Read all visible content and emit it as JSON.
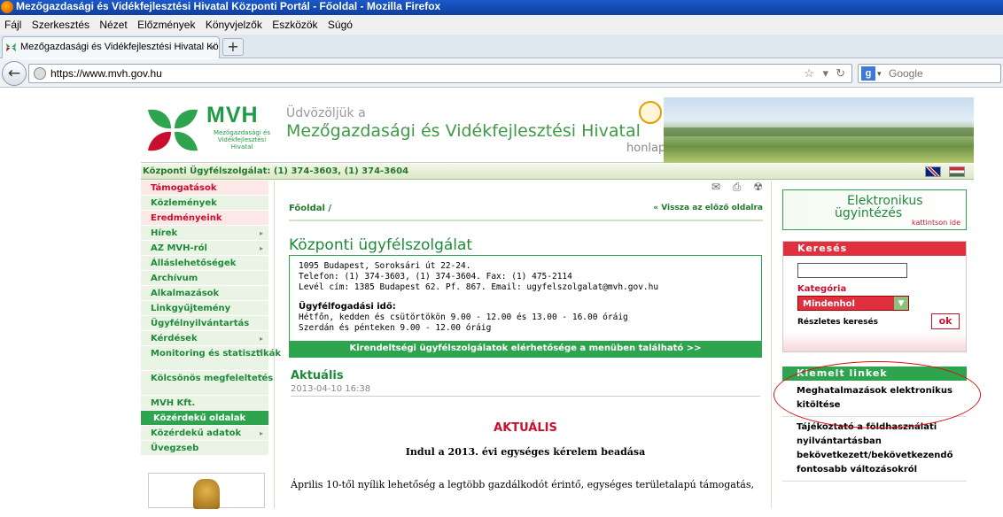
{
  "window": {
    "title": "Mezőgazdasági és Vidékfejlesztési Hivatal Központi Portál - Főoldal - Mozilla Firefox"
  },
  "menu": [
    "Fájl",
    "Szerkesztés",
    "Nézet",
    "Előzmények",
    "Könyvjelzők",
    "Eszközök",
    "Súgó"
  ],
  "tab": {
    "label": "Mezőgazdasági és Vidékfejlesztési Hivatal Kö...",
    "close": "×",
    "new": "+"
  },
  "nav": {
    "url": "https://www.mvh.gov.hu",
    "search_placeholder": "Google",
    "back": "←"
  },
  "banner": {
    "logo": "MVH",
    "logo_sub": "Mezőgazdasági és Vidékfejlesztési Hivatal",
    "welcome1": "Üdvözöljük a",
    "welcome2": "Mezőgazdasági és Vidékfejlesztési Hivatal",
    "welcome3": "honlapján!"
  },
  "infoline": "Központi Ügyfélszolgálat: (1) 374-3603, (1) 374-3604",
  "leftnav": [
    {
      "label": "Támogatások",
      "style": "red",
      "arrow": false
    },
    {
      "label": "Közlemények",
      "style": "",
      "arrow": false
    },
    {
      "label": "Eredményeink",
      "style": "red",
      "arrow": false
    },
    {
      "label": "Hírek",
      "style": "",
      "arrow": true
    },
    {
      "label": "AZ MVH-ról",
      "style": "",
      "arrow": true
    },
    {
      "label": "Álláslehetőségek",
      "style": "",
      "arrow": false
    },
    {
      "label": "Archívum",
      "style": "",
      "arrow": false
    },
    {
      "label": "Alkalmazások",
      "style": "",
      "arrow": false
    },
    {
      "label": "Linkgyűjtemény",
      "style": "",
      "arrow": false
    },
    {
      "label": "Ügyfélnyilvántartás",
      "style": "",
      "arrow": false
    },
    {
      "label": "Kérdések",
      "style": "",
      "arrow": true
    },
    {
      "label": "Monitoring és statisztikák",
      "style": "two",
      "arrow": true
    },
    {
      "label": "Kölcsönös megfeleltetés",
      "style": "two",
      "arrow": true
    },
    {
      "label": "MVH Kft.",
      "style": "",
      "arrow": false
    },
    {
      "label": "Közérdekű oldalak",
      "style": "sel",
      "arrow": false
    },
    {
      "label": "Közérdekű adatok",
      "style": "",
      "arrow": true
    },
    {
      "label": "Üvegzseb",
      "style": "",
      "arrow": false
    }
  ],
  "main": {
    "breadcrumb": "Főoldal /",
    "back": "« Vissza az előző oldalra",
    "heading": "Központi ügyfélszolgálat",
    "address": "1095 Budapest, Soroksári út 22-24.",
    "phone": "Telefon: (1) 374-3603, (1) 374-3604. Fax: (1) 475-2114",
    "mail": "Levél cím: 1385 Budapest 62. Pf. 867. Email: ugyfelszolgalat@mvh.gov.hu",
    "hours_title": "Ügyfélfogadási idő:",
    "hours1": "Hétfőn, kedden és csütörtökön 9.00 - 12.00 és 13.00 - 16.00 óráig",
    "hours2": "Szerdán és pénteken 9.00 - 12.00 óráig",
    "bar": "Kirendeltségi ügyfélszolgálatok elérhetősége a menüben található >>",
    "aktualis": "Aktuális",
    "date": "2013-04-10 16:38",
    "aktualis_red": "AKTUÁLIS",
    "headline": "Indul a 2013. évi egységes kérelem beadása",
    "body": "Április 10-től nyílik lehetőség a legtöbb gazdálkodót érintő, egységes területalapú támogatás,"
  },
  "right": {
    "eugy1": "Elektronikus",
    "eugy2": "ügyintézés",
    "eugy3": "kattintson ide",
    "search_title": "Keresés",
    "category_label": "Kategória",
    "category_value": "Mindenhol",
    "advanced": "Részletes keresés",
    "ok": "ok",
    "links_title": "Kiemelt linkek",
    "links": [
      "Meghatalmazások elektronikus kitöltése",
      "Tájékoztató a földhasználati nyilvántartásban bekövetkezett/bekövetkezendő fontosabb változásokról"
    ]
  }
}
